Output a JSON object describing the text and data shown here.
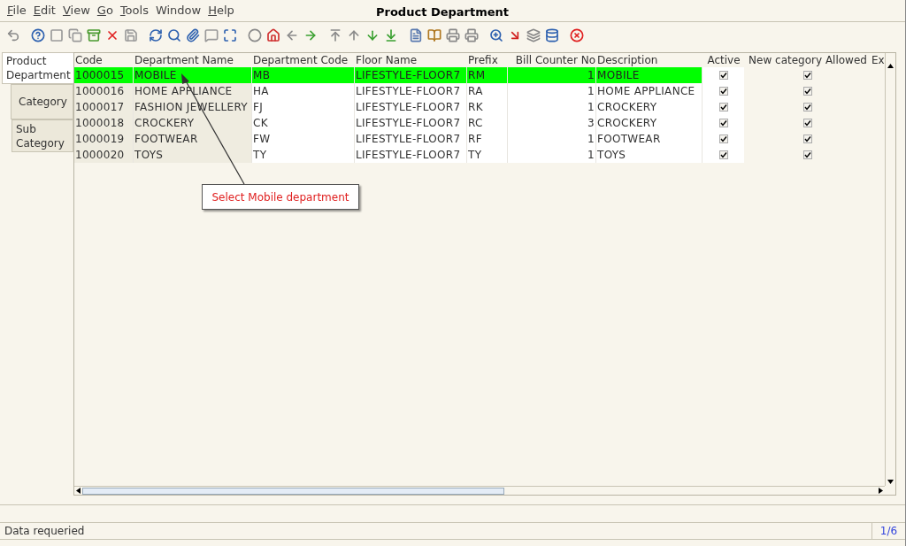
{
  "menu": [
    {
      "label": "File",
      "mnemonic": true
    },
    {
      "label": "Edit",
      "mnemonic": true
    },
    {
      "label": "View",
      "mnemonic": true
    },
    {
      "label": "Go",
      "mnemonic": true
    },
    {
      "label": "Tools",
      "mnemonic": true
    },
    {
      "label": "Window",
      "mnemonic": false
    },
    {
      "label": "Help",
      "mnemonic": true
    }
  ],
  "window": {
    "title": "Product Department"
  },
  "side_tabs": [
    {
      "label": "Product Department",
      "selected": true
    },
    {
      "label": "Category",
      "selected": false
    },
    {
      "label": "Sub Category",
      "selected": false
    }
  ],
  "table": {
    "columns": [
      "Code",
      "Department Name",
      "Department Code",
      "Floor Name",
      "Prefix",
      "Bill Counter No",
      "Description",
      "Active",
      "New category Allowed",
      "Ex"
    ],
    "rows": [
      {
        "code": "1000015",
        "name": "MOBILE",
        "dept_code": "MB",
        "floor": "LIFESTYLE-FLOOR7",
        "prefix": "RM",
        "bill_counter": "1",
        "description": "MOBILE",
        "active": true,
        "new_category_allowed": true,
        "selected": true
      },
      {
        "code": "1000016",
        "name": "HOME APPLIANCE",
        "dept_code": "HA",
        "floor": "LIFESTYLE-FLOOR7",
        "prefix": "RA",
        "bill_counter": "1",
        "description": "HOME APPLIANCE",
        "active": true,
        "new_category_allowed": true,
        "selected": false
      },
      {
        "code": "1000017",
        "name": "FASHION JEWELLERY",
        "dept_code": "FJ",
        "floor": "LIFESTYLE-FLOOR7",
        "prefix": "RK",
        "bill_counter": "1",
        "description": "CROCKERY",
        "active": true,
        "new_category_allowed": true,
        "selected": false
      },
      {
        "code": "1000018",
        "name": "CROCKERY",
        "dept_code": "CK",
        "floor": "LIFESTYLE-FLOOR7",
        "prefix": "RC",
        "bill_counter": "3",
        "description": "CROCKERY",
        "active": true,
        "new_category_allowed": true,
        "selected": false
      },
      {
        "code": "1000019",
        "name": "FOOTWEAR",
        "dept_code": "FW",
        "floor": "LIFESTYLE-FLOOR7",
        "prefix": "RF",
        "bill_counter": "1",
        "description": "FOOTWEAR",
        "active": true,
        "new_category_allowed": true,
        "selected": false
      },
      {
        "code": "1000020",
        "name": "TOYS",
        "dept_code": "TY",
        "floor": "LIFESTYLE-FLOOR7",
        "prefix": "TY",
        "bill_counter": "1",
        "description": "TOYS",
        "active": true,
        "new_category_allowed": true,
        "selected": false
      }
    ]
  },
  "callout": {
    "text": "Select Mobile department"
  },
  "status_bar": {
    "message": "Data requeried",
    "record": "1/6"
  }
}
